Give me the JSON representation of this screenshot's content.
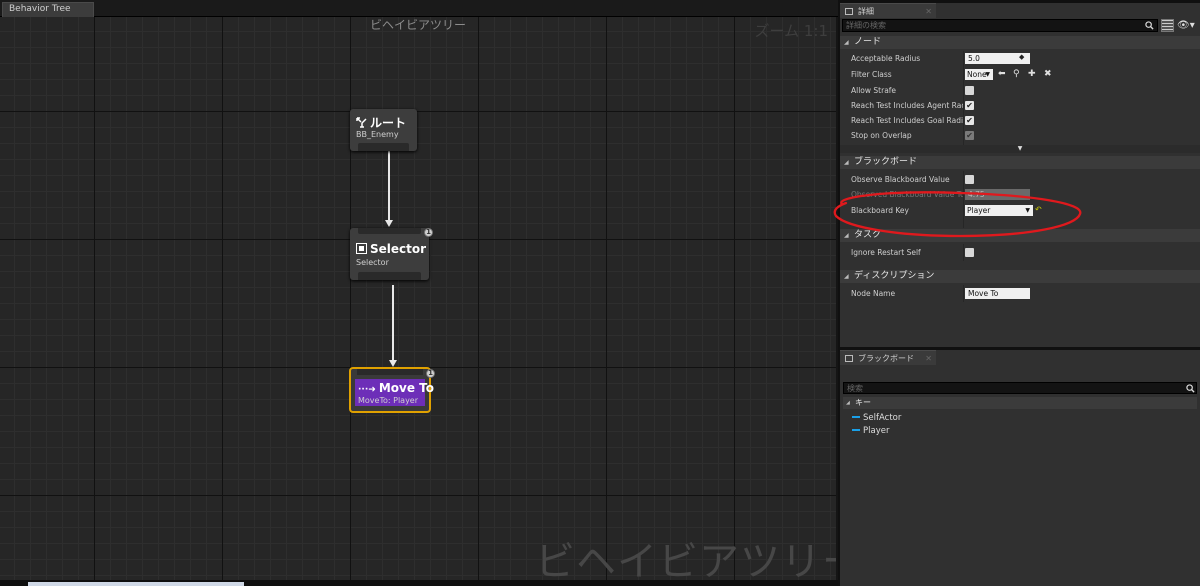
{
  "top_tab": {
    "label": "Behavior Tree"
  },
  "graph": {
    "title": "ビヘイビアツリー",
    "zoom": "ズーム 1:1",
    "watermark": "ビヘイビアツリー"
  },
  "nodes": {
    "root": {
      "title": "ルート",
      "subtitle": "BB_Enemy"
    },
    "selector": {
      "title": "Selector",
      "subtitle": "Selector",
      "badge": "1"
    },
    "moveto": {
      "title": "Move To",
      "subtitle": "MoveTo: Player",
      "badge": "1"
    }
  },
  "details": {
    "tab_label": "詳細",
    "search_placeholder": "詳細の検索",
    "categories": {
      "node": "ノード",
      "blackboard": "ブラックボード",
      "task": "タスク",
      "description": "ディスクリプション"
    },
    "node_props": {
      "acceptable_radius": {
        "label": "Acceptable Radius",
        "value": "5.0"
      },
      "filter_class": {
        "label": "Filter Class",
        "value": "None"
      },
      "allow_strafe": {
        "label": "Allow Strafe",
        "checked": false
      },
      "reach_agent": {
        "label": "Reach Test Includes Agent Radius",
        "checked": true
      },
      "reach_goal": {
        "label": "Reach Test Includes Goal Radius",
        "checked": true
      },
      "stop_overlap": {
        "label": "Stop on Overlap",
        "checked": true
      }
    },
    "bb_props": {
      "observe_value": {
        "label": "Observe Blackboard Value",
        "checked": false
      },
      "observed_tolerance": {
        "label": "Observed Blackboard Value Toleran",
        "value": "4.75"
      },
      "blackboard_key": {
        "label": "Blackboard Key",
        "value": "Player"
      }
    },
    "task_props": {
      "ignore_restart": {
        "label": "Ignore Restart Self",
        "checked": false
      }
    },
    "desc_props": {
      "node_name": {
        "label": "Node Name",
        "value": "Move To"
      }
    }
  },
  "blackboard_panel": {
    "tab_label": "ブラックボード",
    "search_placeholder": "検索",
    "keys_header": "キー",
    "keys": [
      "SelfActor",
      "Player"
    ]
  },
  "colors": {
    "annotation": "#e0191d",
    "selected_outline": "#e0a100",
    "moveto_fill": "#6d2eb8",
    "key_swatch": "#1aa0e8"
  }
}
